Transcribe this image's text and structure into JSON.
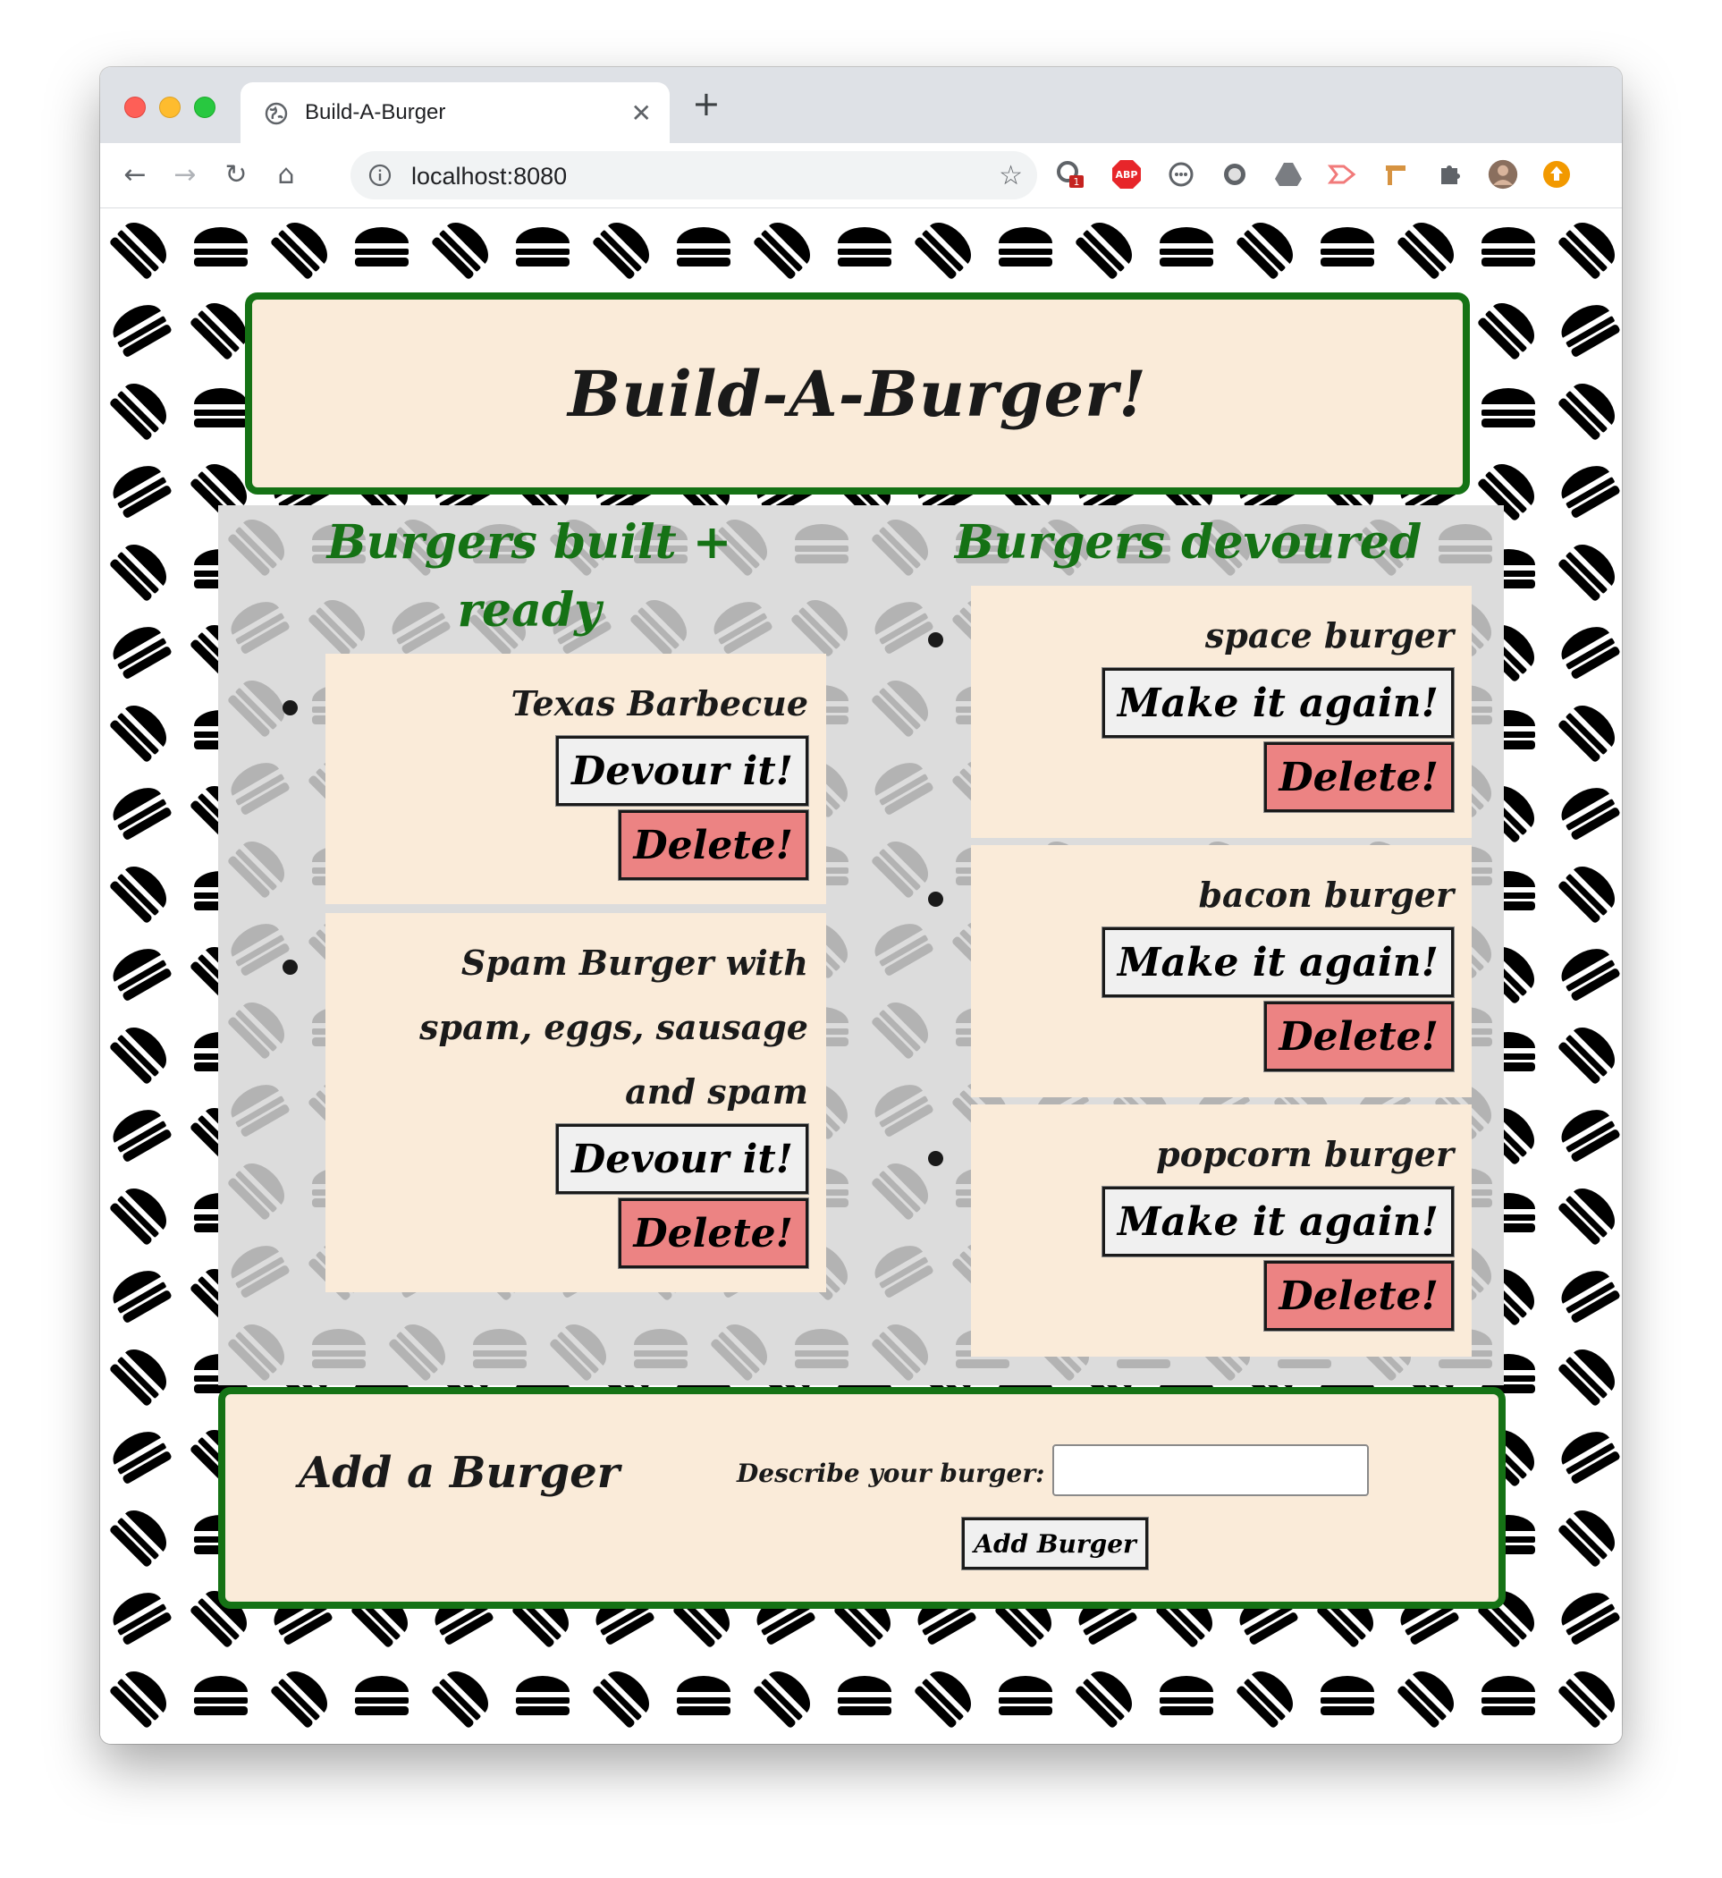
{
  "browser": {
    "tab_title": "Build-A-Burger",
    "url": "localhost:8080",
    "extension_badge": "1",
    "abp_label": "ABP"
  },
  "page": {
    "title": "Build-A-Burger!",
    "ready": {
      "heading": "Burgers built + ready",
      "items": [
        {
          "name": "Texas Barbecue",
          "primary_button": "Devour it!",
          "delete_button": "Delete!"
        },
        {
          "name": "Spam Burger with spam, eggs, sausage and spam",
          "primary_button": "Devour it!",
          "delete_button": "Delete!"
        }
      ]
    },
    "devoured": {
      "heading": "Burgers devoured",
      "items": [
        {
          "name": "space burger",
          "primary_button": "Make it again!",
          "delete_button": "Delete!"
        },
        {
          "name": "bacon burger",
          "primary_button": "Make it again!",
          "delete_button": "Delete!"
        },
        {
          "name": "popcorn burger",
          "primary_button": "Make it again!",
          "delete_button": "Delete!"
        }
      ]
    },
    "add_form": {
      "title": "Add a Burger",
      "label": "Describe your burger:",
      "input_value": "",
      "submit_label": "Add Burger"
    }
  },
  "colors": {
    "accent_green": "#157215",
    "card_bg": "#faebd9",
    "delete_red": "#ec8383"
  }
}
